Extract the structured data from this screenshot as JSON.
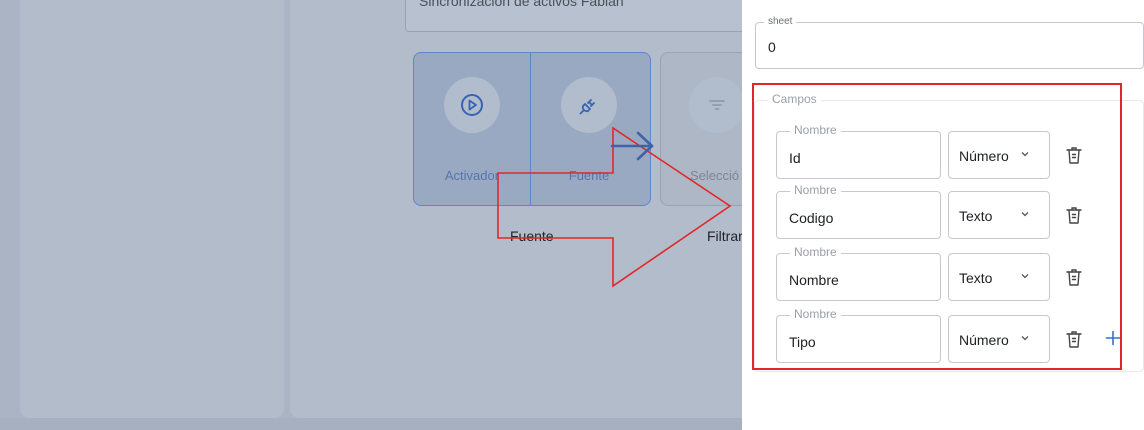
{
  "background": {
    "flow_name_value": "Sincronización de activos Fabian",
    "nodes": [
      {
        "label": "Activador",
        "icon": "play-circle-icon"
      },
      {
        "label": "Fuente",
        "icon": "plug-icon"
      },
      {
        "label": "Selecció",
        "icon": "filter-icon"
      }
    ],
    "below_labels": {
      "fuente": "Fuente",
      "filtrar": "Filtrar"
    }
  },
  "drawer": {
    "sheet": {
      "label": "sheet",
      "value": "0"
    },
    "campos": {
      "legend": "Campos",
      "fields": [
        {
          "name_label": "Nombre",
          "name_value": "Id",
          "type": "Número"
        },
        {
          "name_label": "Nombre",
          "name_value": "Codigo",
          "type": "Texto"
        },
        {
          "name_label": "Nombre",
          "name_value": "Nombre",
          "type": "Texto"
        },
        {
          "name_label": "Nombre",
          "name_value": "Tipo",
          "type": "Número"
        }
      ]
    }
  },
  "colors": {
    "accent": "#2f6fd6",
    "annotation_red": "#e02828",
    "overlay": "#aab4c4"
  }
}
